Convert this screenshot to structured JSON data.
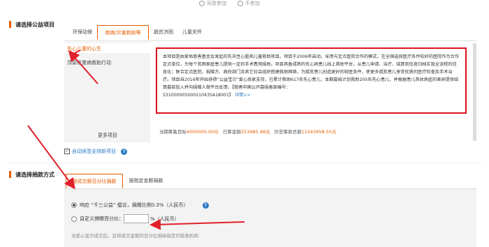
{
  "top_options": {
    "opt1": "同意参加",
    "opt2": "不参加"
  },
  "section1": {
    "title": "请选择公益项目",
    "tabs": [
      "环保动保",
      "疾病/灾害救助等",
      "脱贫济困",
      "儿童关怀"
    ],
    "sidebar_items": [
      "先心儿童的心生",
      "顶梁柱重病救助行动"
    ],
    "more_label": "更多项目",
    "description": "本项目是由爱佑慈善基金会发起的先天性心脏病儿童救助项目。项目于2006年启动，采用与定点医院合作的模式，在全国选择医疗条件较好的医院作为合作定点单位，为每个贫困家庭患儿提供一定的手术费用捐助。项目具备成熟的先心病患儿线上救助平台，从患儿申请、治疗、结算到信息归档实现全流程的信息化；联合定点医院、捐赠方、政府部门及其它社会组织搭建救助网络，为孤贫患儿创造更好的就医条件，使更多孤贫患儿享受优质的医疗检查及手术治疗。项目自2016年开始获得“公益宝贝”爱心商家支持，已累计救助617名先心患儿，本期募捐计划救助205名先心患儿，并根据患儿具体病症的差异提供结算募款投入并向捐赠人做平台反馈。【慈善中国公开募捐备案编号：",
    "record_no": "531000005000210435A18001】",
    "details_link": "详情>>",
    "target_label": "当期筹集目标",
    "target_value": "4000000.00元",
    "raised_label": "已筹金额",
    "raised_value": "253485.48元",
    "history_label": "历史筹款总额",
    "history_value": "11543958.55元",
    "auto_renew_label": "自动续签支持新项目"
  },
  "section2": {
    "title": "请选择捐款方式",
    "tabs": [
      "按成交额百分比捐款",
      "按指定金额捐款"
    ],
    "option1_text": "响应 “千三公益” 倡议，捐赠比例0.3%（人民币）",
    "option2_prefix": "自定义捐赠百分比：",
    "option2_suffix": "%（人民币）",
    "footer_note": "当爱心宝贝成交后，会将成交金额的百分比捐给指定的慈善机构"
  },
  "colors": {
    "accent": "#e65c00",
    "highlight_red": "#d9121b",
    "link_blue": "#2a7ac6"
  }
}
